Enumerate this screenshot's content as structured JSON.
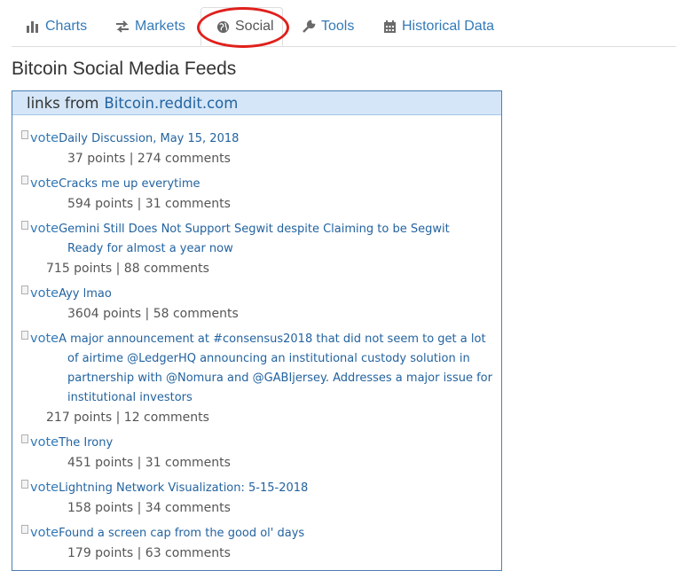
{
  "tabs": [
    {
      "label": "Charts",
      "icon": "bar-chart-icon"
    },
    {
      "label": "Markets",
      "icon": "exchange-arrows-icon"
    },
    {
      "label": "Social",
      "icon": "globe-icon"
    },
    {
      "label": "Tools",
      "icon": "wrench-icon"
    },
    {
      "label": "Historical Data",
      "icon": "calendar-icon"
    }
  ],
  "active_tab": "Social",
  "page": {
    "title": "Bitcoin Social Media Feeds"
  },
  "panel": {
    "heading_prefix": "links from",
    "heading_link": "Bitcoin.reddit.com"
  },
  "vote_alt": "vote",
  "feed": [
    {
      "title": "Daily Discussion, May 15, 2018",
      "meta": "37 points | 274 comments"
    },
    {
      "title": "Cracks me up everytime",
      "meta": "594 points | 31 comments"
    },
    {
      "title_lines": [
        "Gemini Still Does Not Support Segwit despite Claiming to be Segwit",
        "Ready for almost a year now"
      ],
      "meta": "715 points | 88 comments"
    },
    {
      "title": "Ayy lmao",
      "meta": "3604 points | 58 comments"
    },
    {
      "title_lines": [
        "A major announcement at #consensus2018 that did not seem to get a lot",
        "of airtime @LedgerHQ announcing an institutional custody solution in",
        "partnership with @Nomura and @GABIjersey. Addresses a major issue for",
        "institutional investors"
      ],
      "meta": "217 points | 12 comments"
    },
    {
      "title": "The Irony",
      "meta": "451 points | 31 comments"
    },
    {
      "title": "Lightning Network Visualization: 5-15-2018",
      "meta": "158 points | 34 comments"
    },
    {
      "title": "Found a screen cap from the good ol' days",
      "meta": "179 points | 63 comments"
    }
  ],
  "colors": {
    "link": "#337ab7",
    "highlight_ring": "#e0201c",
    "panel_heading_bg": "#d4e6f7",
    "panel_border": "#4a7fb5"
  }
}
